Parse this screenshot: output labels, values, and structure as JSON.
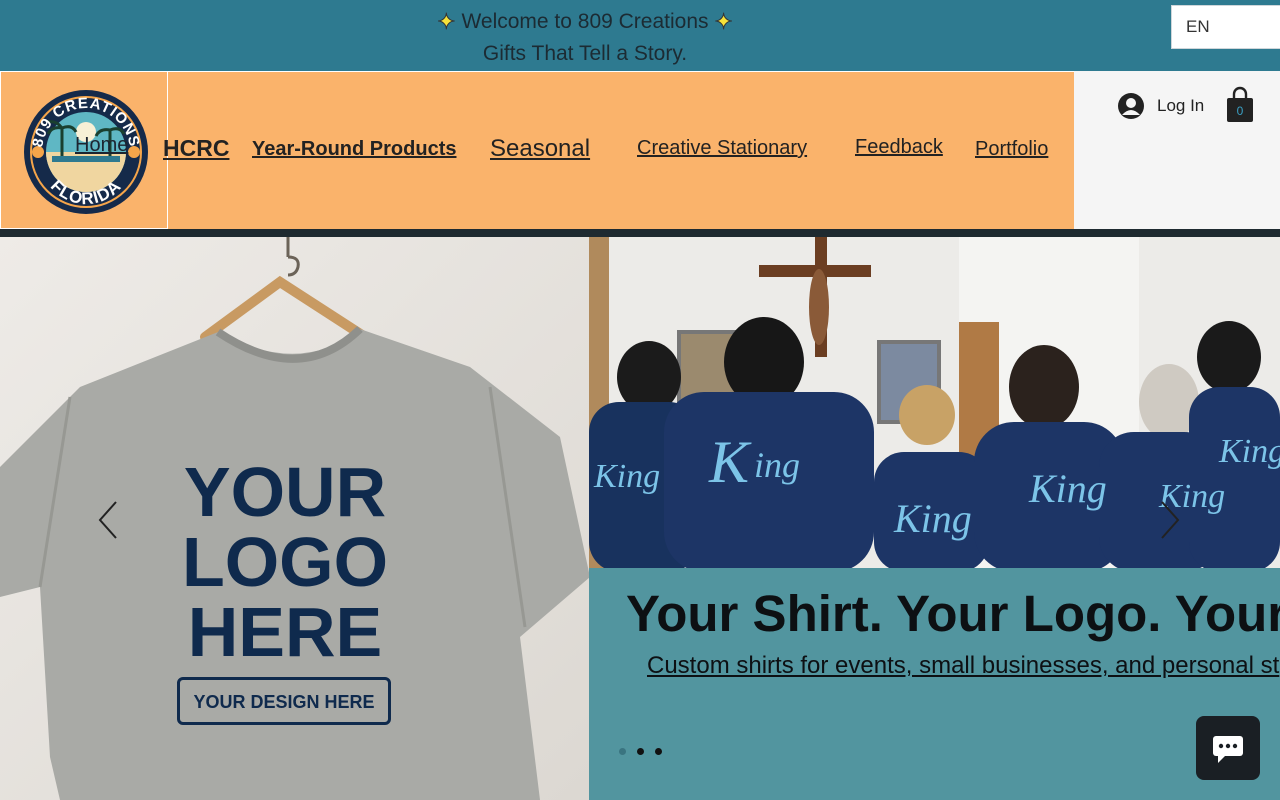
{
  "banner": {
    "line1": "Welcome to 809 Creations",
    "line2": "Gifts That Tell a Story."
  },
  "language": {
    "selected": "EN"
  },
  "logo": {
    "alt_label": "Home"
  },
  "nav": {
    "items": [
      "HCRC",
      "Year-Round Products",
      "Seasonal",
      "Creative Stationary",
      "Feedback",
      "Portfolio"
    ]
  },
  "account": {
    "login_label": "Log In",
    "cart_count": "0"
  },
  "hero": {
    "left_shirt": {
      "line1": "YOUR",
      "line2": "LOGO",
      "line3": "HERE",
      "badge": "YOUR DESIGN HERE"
    },
    "title": "Your Shirt. Your Logo. Your",
    "subtitle": "Custom shirts for events, small businesses, and personal st",
    "slides": {
      "count": 3,
      "active": 0
    }
  },
  "colors": {
    "banner": "#2e7a90",
    "header": "#fab36b",
    "panel": "#52959f",
    "divider": "#1e2a30",
    "text_dark": "#0d1013",
    "shirt_ink": "#0f2a4d"
  },
  "icons": {
    "login": "user-circle-icon",
    "cart": "shopping-bag-icon",
    "prev": "chevron-left-icon",
    "next": "chevron-right-icon",
    "chat": "chat-bubble-icon",
    "sparkle": "sparkle-icon"
  }
}
